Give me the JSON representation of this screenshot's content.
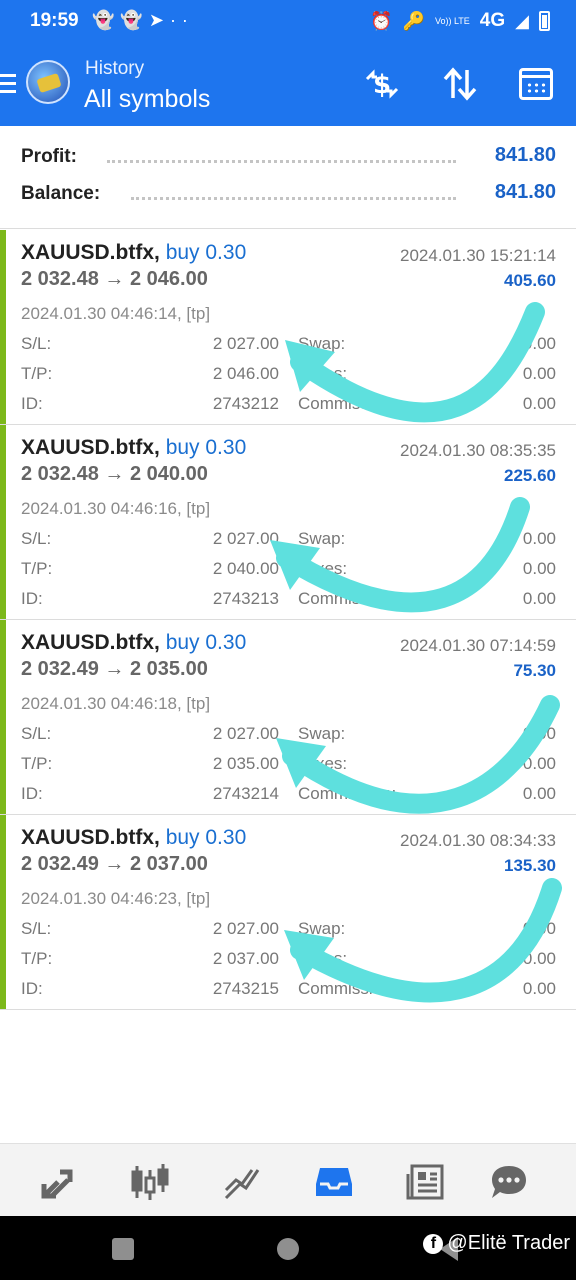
{
  "status_bar": {
    "time": "19:59",
    "left_icons": [
      "snapchat-icon",
      "snapchat-icon",
      "telegram-icon",
      "more-dots"
    ],
    "right_icons": [
      "alarm-icon",
      "key-icon",
      "volte-icon",
      "signal-icon",
      "battery-icon"
    ],
    "volte_label": "Vo)) LTE",
    "network": "4G"
  },
  "header": {
    "subtitle": "History",
    "title": "All symbols",
    "actions": [
      "currency-exchange-icon",
      "sort-icon",
      "calendar-icon"
    ]
  },
  "summary": {
    "profit_label": "Profit:",
    "profit_value": "841.80",
    "balance_label": "Balance:",
    "balance_value": "841.80"
  },
  "trades": [
    {
      "symbol": "XAUUSD.btfx,",
      "direction": "buy 0.30",
      "prices": "2 032.48 → 2 046.00",
      "close_time": "2024.01.30 15:21:14",
      "profit": "405.60",
      "open_time": "2024.01.30 04:46:14, [tp]",
      "sl_label": "S/L:",
      "sl_value": "2 027.00",
      "tp_label": "T/P:",
      "tp_value": "2 046.00",
      "id_label": "ID:",
      "id_value": "2743212",
      "swap_label": "Swap:",
      "swap_value": "0.00",
      "taxes_label": "Taxes:",
      "taxes_value": "0.00",
      "commission_label": "Commission:",
      "commission_value": "0.00"
    },
    {
      "symbol": "XAUUSD.btfx,",
      "direction": "buy 0.30",
      "prices": "2 032.48 → 2 040.00",
      "close_time": "2024.01.30 08:35:35",
      "profit": "225.60",
      "open_time": "2024.01.30 04:46:16, [tp]",
      "sl_label": "S/L:",
      "sl_value": "2 027.00",
      "tp_label": "T/P:",
      "tp_value": "2 040.00",
      "id_label": "ID:",
      "id_value": "2743213",
      "swap_label": "Swap:",
      "swap_value": "0.00",
      "taxes_label": "Taxes:",
      "taxes_value": "0.00",
      "commission_label": "Commission:",
      "commission_value": "0.00"
    },
    {
      "symbol": "XAUUSD.btfx,",
      "direction": "buy 0.30",
      "prices": "2 032.49 → 2 035.00",
      "close_time": "2024.01.30 07:14:59",
      "profit": "75.30",
      "open_time": "2024.01.30 04:46:18, [tp]",
      "sl_label": "S/L:",
      "sl_value": "2 027.00",
      "tp_label": "T/P:",
      "tp_value": "2 035.00",
      "id_label": "ID:",
      "id_value": "2743214",
      "swap_label": "Swap:",
      "swap_value": "0.00",
      "taxes_label": "Taxes:",
      "taxes_value": "0.00",
      "commission_label": "Commission:",
      "commission_value": "0.00"
    },
    {
      "symbol": "XAUUSD.btfx,",
      "direction": "buy 0.30",
      "prices": "2 032.49 → 2 037.00",
      "close_time": "2024.01.30 08:34:33",
      "profit": "135.30",
      "open_time": "2024.01.30 04:46:23, [tp]",
      "sl_label": "S/L:",
      "sl_value": "2 027.00",
      "tp_label": "T/P:",
      "tp_value": "2 037.00",
      "id_label": "ID:",
      "id_value": "2743215",
      "swap_label": "Swap:",
      "swap_value": "0.00",
      "taxes_label": "Taxes:",
      "taxes_value": "0.00",
      "commission_label": "Commission:",
      "commission_value": "0.00"
    }
  ],
  "bottom_nav": [
    "quotes-icon",
    "chart-icon",
    "trade-icon",
    "history-icon",
    "news-icon",
    "chat-icon"
  ],
  "bottom_nav_active": "history-icon",
  "watermark": "@Elitë Trader",
  "colors": {
    "header_bg": "#1e75ee",
    "accent_bar": "#7cb81a",
    "value_blue": "#1a62c7",
    "overlay_arrow": "#5ee0de",
    "active_nav": "#1e75ee"
  }
}
